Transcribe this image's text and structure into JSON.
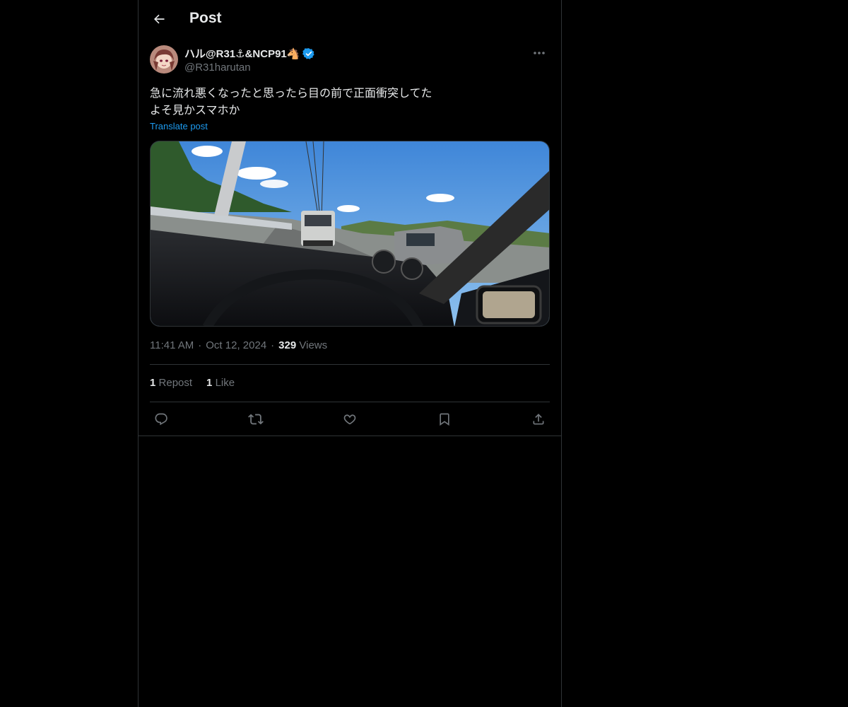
{
  "header": {
    "title": "Post",
    "back_icon": "arrow-left-icon"
  },
  "post": {
    "author": {
      "display_name": "ハル@R31⚓&NCP91🐴",
      "handle": "@R31harutan",
      "verified": true
    },
    "text": "急に流れ悪くなったと思ったら目の前で正面衝突してた\nよそ見かスマホか",
    "translate_label": "Translate post",
    "time": "11:41 AM",
    "separator": "·",
    "date": "Oct 12, 2024",
    "views_count": "329",
    "views_label": "Views",
    "reposts_count": "1",
    "reposts_label": "Repost",
    "likes_count": "1",
    "likes_label": "Like"
  },
  "actions": [
    "reply-icon",
    "repost-icon",
    "like-icon",
    "bookmark-icon",
    "share-icon"
  ],
  "colors": {
    "background": "#000000",
    "text": "#e7e9ea",
    "muted": "#71767b",
    "link": "#1d9bf0",
    "border": "#2f3336",
    "verified": "#1d9bf0"
  }
}
